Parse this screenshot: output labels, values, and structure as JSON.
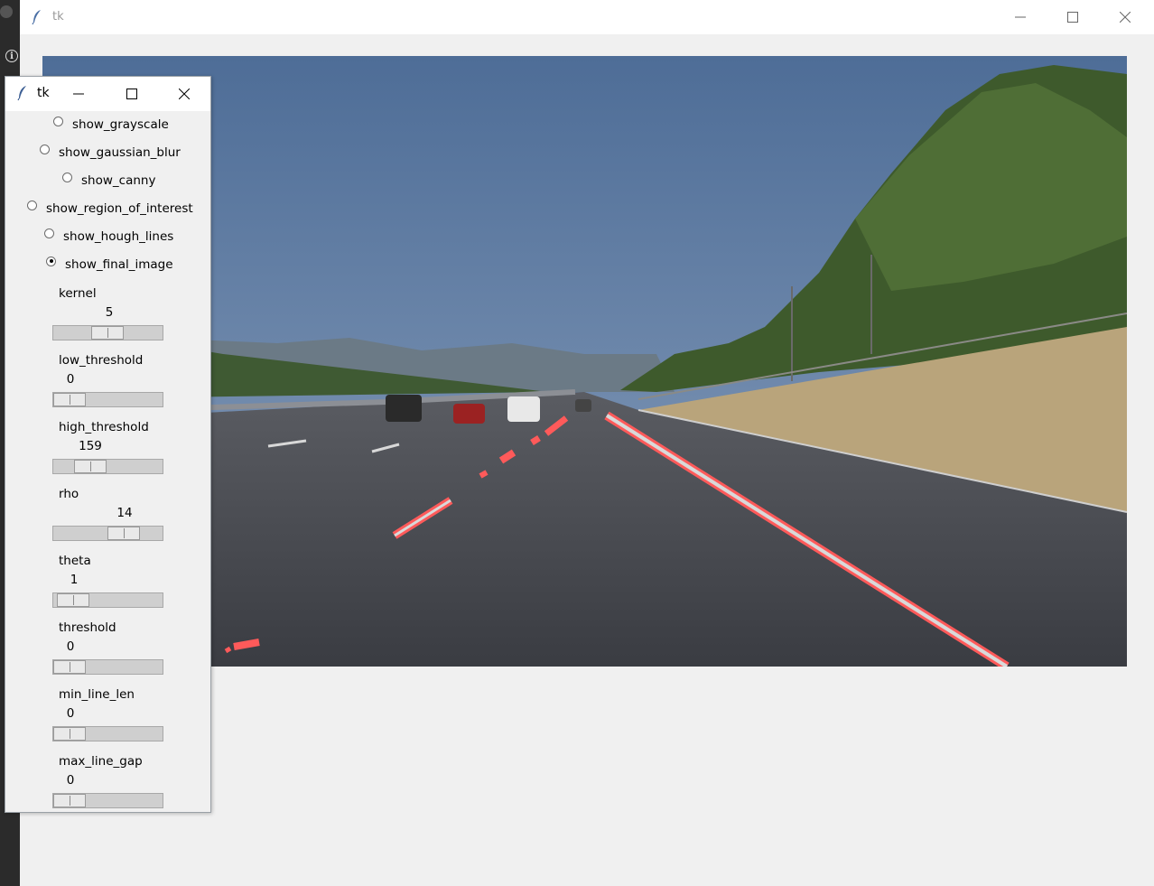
{
  "main_window": {
    "title": "tk"
  },
  "panel_window": {
    "title": "tk"
  },
  "radios": [
    {
      "label": "show_grayscale",
      "checked": false
    },
    {
      "label": "show_gaussian_blur",
      "checked": false
    },
    {
      "label": "show_canny",
      "checked": false
    },
    {
      "label": "show_region_of_interest",
      "checked": false
    },
    {
      "label": "show_hough_lines",
      "checked": false
    },
    {
      "label": "show_final_image",
      "checked": true
    }
  ],
  "sliders": [
    {
      "label": "kernel",
      "value": "5"
    },
    {
      "label": "low_threshold",
      "value": "0"
    },
    {
      "label": "high_threshold",
      "value": "159"
    },
    {
      "label": "rho",
      "value": "14"
    },
    {
      "label": "theta",
      "value": "1"
    },
    {
      "label": "threshold",
      "value": "0"
    },
    {
      "label": "min_line_len",
      "value": "0"
    },
    {
      "label": "max_line_gap",
      "value": "0"
    }
  ],
  "colors": {
    "lane_line": "#ff5a5a",
    "sky": "#5f7fa8",
    "road": "#3f4147"
  }
}
